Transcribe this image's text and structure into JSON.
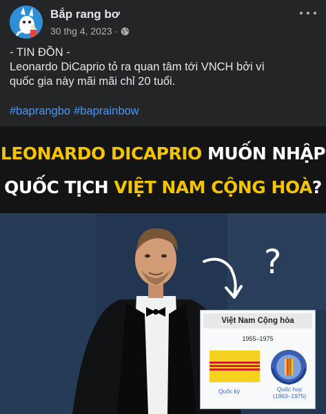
{
  "post": {
    "page_name": "Bắp rang bơ",
    "timestamp": "30 thg 4, 2023",
    "separator": "·",
    "privacy_icon": "globe-icon",
    "more_icon": "more-options-icon",
    "text_lines": [
      "- TIN ĐỒN -",
      "Leonardo DiCaprio tỏ ra quan tâm tới VNCH bởi vì",
      "quốc gia này mãi mãi chỉ 20 tuổi."
    ],
    "hashtags": [
      "#baprangbo",
      "#baprainbow"
    ]
  },
  "image": {
    "headline_1": {
      "yellow": "LEONARDO DICAPRIO",
      "white": " MUỐN NHẬP"
    },
    "headline_2": {
      "white": "QUỐC TỊCH ",
      "yellow": "VIỆT NAM CỘNG HOÀ",
      "white_end": "?"
    },
    "question_mark": "?",
    "infobox": {
      "title": "Việt Nam Cộng hòa",
      "years": "1955–1975",
      "flag_caption": "Quốc kỳ",
      "emblem_caption_line1": "Quốc huy",
      "emblem_caption_line2": "(1963–1975)"
    }
  },
  "colors": {
    "background": "#242526",
    "text": "#e4e6eb",
    "secondary_text": "#b0b3b8",
    "hashtag": "#4599ff",
    "headline_yellow": "#f5c400",
    "flag_yellow": "#f5d21f",
    "flag_red": "#d32027"
  }
}
